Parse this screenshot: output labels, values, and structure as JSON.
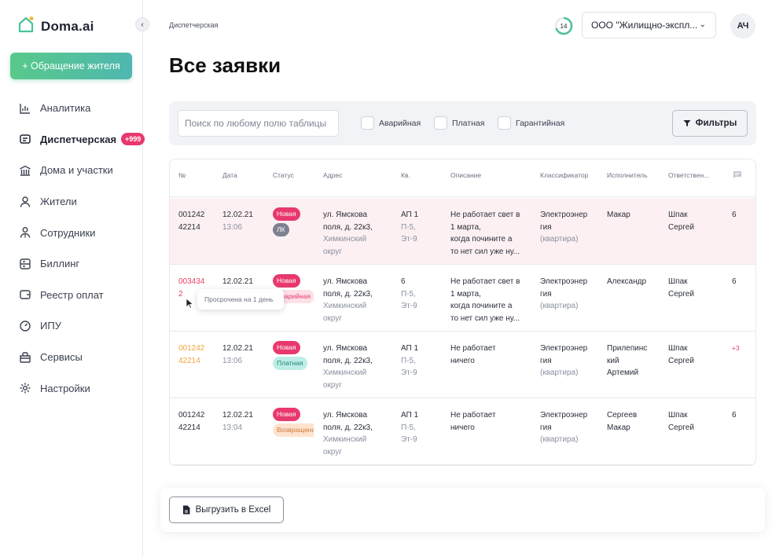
{
  "app": {
    "logo_text": "Doma.ai"
  },
  "sidebar": {
    "appeal_button": "+ Обращение жителя",
    "items": [
      {
        "label": "Аналитика",
        "icon": "chart-icon"
      },
      {
        "label": "Диспетчерская",
        "icon": "dispatch-icon",
        "badge": "+999",
        "active": true
      },
      {
        "label": "Дома и участки",
        "icon": "building-icon"
      },
      {
        "label": "Жители",
        "icon": "user-icon"
      },
      {
        "label": "Сотрудники",
        "icon": "employees-icon"
      },
      {
        "label": "Биллинг",
        "icon": "billing-icon"
      },
      {
        "label": "Реестр оплат",
        "icon": "wallet-icon"
      },
      {
        "label": "ИПУ",
        "icon": "meter-icon"
      },
      {
        "label": "Сервисы",
        "icon": "services-icon"
      },
      {
        "label": "Настройки",
        "icon": "settings-icon"
      }
    ]
  },
  "header": {
    "breadcrumb": "Диспетчерская",
    "progress_value": "14",
    "organization": "ООО \"Жилищно-экспл...",
    "avatar": "АЧ"
  },
  "page": {
    "title": "Все заявки"
  },
  "filters": {
    "search_placeholder": "Поиск по любому полю таблицы",
    "checkboxes": [
      "Аварийная",
      "Платная",
      "Гарантийная"
    ],
    "filters_button": "Фильтры"
  },
  "table": {
    "headers": [
      "№",
      "Дата",
      "Статус",
      "Адрес",
      "Кв.",
      "Описание",
      "Классификатор",
      "Исполнитель",
      "Ответствен..."
    ],
    "rows": [
      {
        "num1": "001242",
        "num2": "42214",
        "date": "12.02.21",
        "time": "13:06",
        "tag1": "Новая",
        "tag2": "ЛК",
        "addr1": "ул. Ямскова",
        "addr2": "поля, д. 22к3,",
        "addr3": "Химкинский",
        "addr4": "округ",
        "apt": "АП 1",
        "apt2": "П-5,",
        "apt3": "Эт-9",
        "desc1": "Не работает свет в",
        "desc2": "1 марта,",
        "desc3": "когда почините а",
        "desc4": "то нет сил уже ну...",
        "class1": "Электроэнер",
        "class2": "гия",
        "class3": "(квартира)",
        "exec1": "Макар",
        "exec2": "",
        "exec3": "",
        "resp1": "Шпак",
        "resp2": "Сергей",
        "comments": "6"
      },
      {
        "num1": "003434",
        "num2": "2",
        "date": "12.02.21",
        "time": "",
        "tag1": "Новая",
        "tag2": "Аварийная",
        "addr1": "ул. Ямскова",
        "addr2": "поля, д. 22к3,",
        "addr3": "Химкинский",
        "addr4": "округ",
        "apt": "6",
        "apt2": "П-5,",
        "apt3": "Эт-9",
        "desc1": "Не работает свет в",
        "desc2": "1 марта,",
        "desc3": "когда почините а",
        "desc4": "то нет сил уже ну...",
        "class1": "Электроэнер",
        "class2": "гия",
        "class3": "(квартира)",
        "exec1": "Александр",
        "exec2": "",
        "exec3": "",
        "resp1": "Шпак",
        "resp2": "Сергей",
        "comments": "6",
        "tooltip": "Просрочена на 1 день"
      },
      {
        "num1": "001242",
        "num2": "42214",
        "date": "12.02.21",
        "time": "13:06",
        "tag1": "Новая",
        "tag2": "Платная",
        "addr1": "ул. Ямскова",
        "addr2": "поля, д. 22к3,",
        "addr3": "Химкинский",
        "addr4": "округ",
        "apt": "АП 1",
        "apt2": "П-5,",
        "apt3": "Эт-9",
        "desc1": "Не работает",
        "desc2": "ничего",
        "desc3": "",
        "desc4": "",
        "class1": "Электроэнер",
        "class2": "гия",
        "class3": "(квартира)",
        "exec1": "Прилепинс",
        "exec2": "кий",
        "exec3": "Артемий",
        "resp1": "Шпак",
        "resp2": "Сергей",
        "comments": "+3"
      },
      {
        "num1": "001242",
        "num2": "42214",
        "date": "12.02.21",
        "time": "13:04",
        "tag1": "Новая",
        "tag2": "Возвращена",
        "addr1": "ул. Ямскова",
        "addr2": "поля, д. 22к3,",
        "addr3": "Химкинский",
        "addr4": "округ",
        "apt": "АП 1",
        "apt2": "П-5,",
        "apt3": "Эт-9",
        "desc1": "Не работает",
        "desc2": "ничего",
        "desc3": "",
        "desc4": "",
        "class1": "Электроэнер",
        "class2": "гия",
        "class3": "(квартира)",
        "exec1": "Сергеев",
        "exec2": "Макар",
        "exec3": "",
        "resp1": "Шпак",
        "resp2": "Сергей",
        "comments": "6"
      }
    ]
  },
  "footer": {
    "export_button": "Выгрузить в Excel"
  },
  "colors": {
    "accent_pink": "#e8386d",
    "overdue_red": "#e9445f",
    "warning_orange": "#f2a33a",
    "green_gradient_start": "#58c98a",
    "green_gradient_end": "#4fb7b0"
  }
}
